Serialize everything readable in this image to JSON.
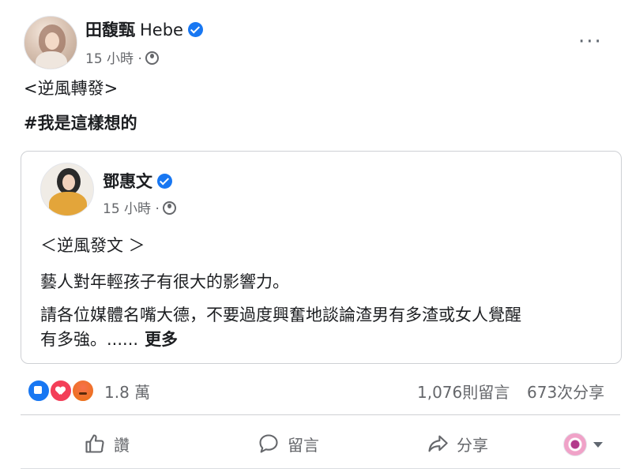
{
  "post": {
    "author_name": "田馥甄",
    "author_latin": "Hebe",
    "time": "15 小時",
    "separator": "·",
    "more_label": "···",
    "text_line1": "<逆風轉發>",
    "text_line2": "#我是這樣想的"
  },
  "shared": {
    "author_name": "鄧惠文",
    "time": "15 小時",
    "separator": "·",
    "line1": "＜逆風發文 ＞",
    "line2": "藝人對年輕孩子有很大的影響力。",
    "line3": "請各位媒體名嘴大德，不要過度興奮地談論渣男有多渣或女人覺醒",
    "line4": "有多強。......",
    "see_more": "更多"
  },
  "stats": {
    "reaction_count": "1.8 萬",
    "comments": "1,076則留言",
    "shares": "673次分享"
  },
  "actions": {
    "like": "讚",
    "comment": "留言",
    "share": "分享"
  },
  "icons": {
    "verified": "verified-badge-icon",
    "globe": "globe-icon",
    "like": "thumbs-up-icon",
    "comment": "comment-bubble-icon",
    "share": "share-arrow-icon"
  },
  "colors": {
    "accent": "#1877f2",
    "text": "#1c1e21",
    "muted": "#65676b",
    "border": "#ced0d4"
  }
}
